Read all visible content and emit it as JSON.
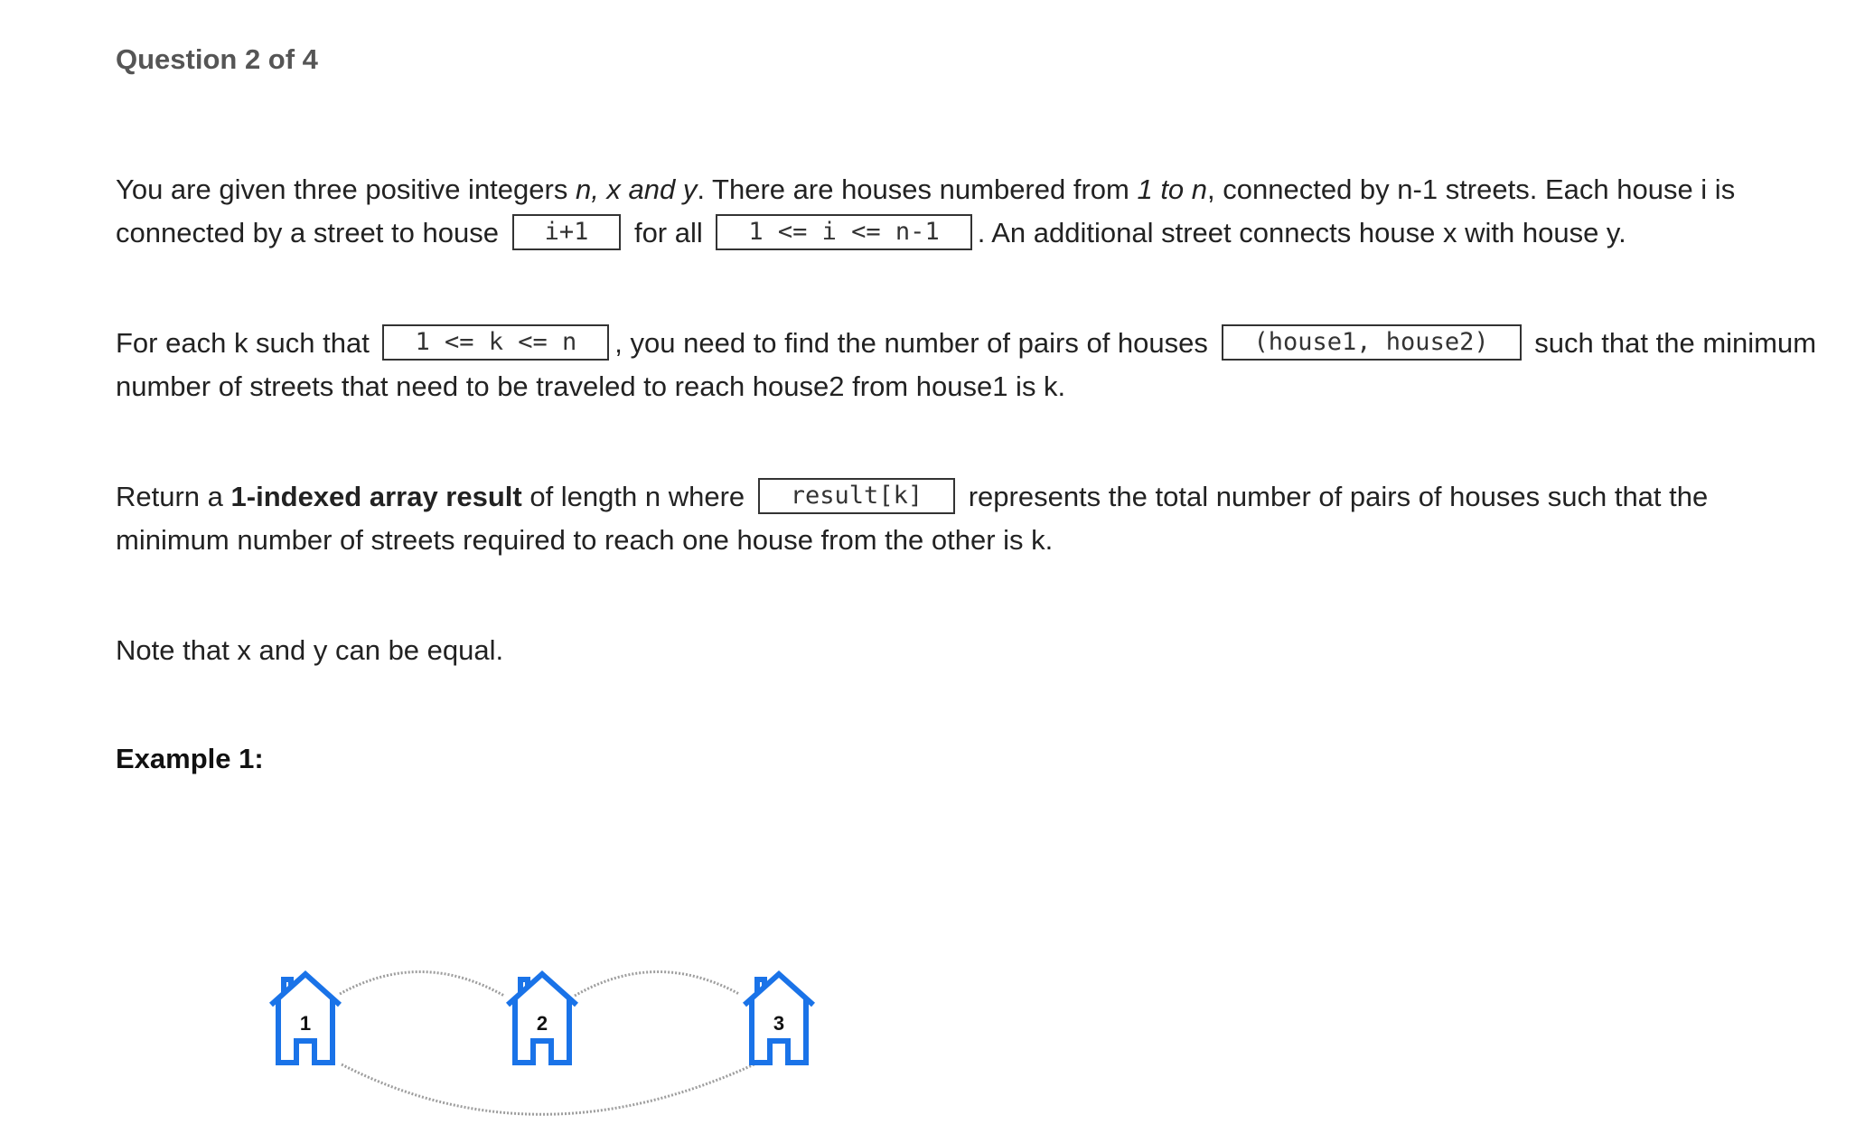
{
  "question": {
    "label": "Question 2 of 4"
  },
  "p1": {
    "a": "You are given three positive integers ",
    "b": "n, x and y",
    "c": ". There are houses numbered from ",
    "d": "1 to n",
    "e": ", connected by n-1 streets. Each house i is",
    "f": "connected by a street to house ",
    "code1": "i+1",
    "g": " for all ",
    "code2": "1 <= i <= n-1",
    "h": ". An additional street connects house x with house y."
  },
  "p2": {
    "a": "For each k such that ",
    "code1": "1 <= k <= n",
    "b": ", you need to find the number of pairs of houses ",
    "code2": "(house1, house2)",
    "c": " such that the minimum",
    "d": "number of streets that need to be traveled to reach house2 from house1 is k."
  },
  "p3": {
    "a": "Return a ",
    "b": "1-indexed array result",
    "c": " of length n where ",
    "code1": "result[k]",
    "d": " represents the total number of pairs of houses such that the",
    "e": "minimum number of streets required to reach one house from the other is k."
  },
  "p4": {
    "text": "Note that x and y can be equal."
  },
  "example": {
    "heading": "Example 1:"
  },
  "diagram": {
    "houses": [
      "1",
      "2",
      "3"
    ],
    "house_color": "#1a73e8",
    "edge_color": "#9e9e9e"
  }
}
